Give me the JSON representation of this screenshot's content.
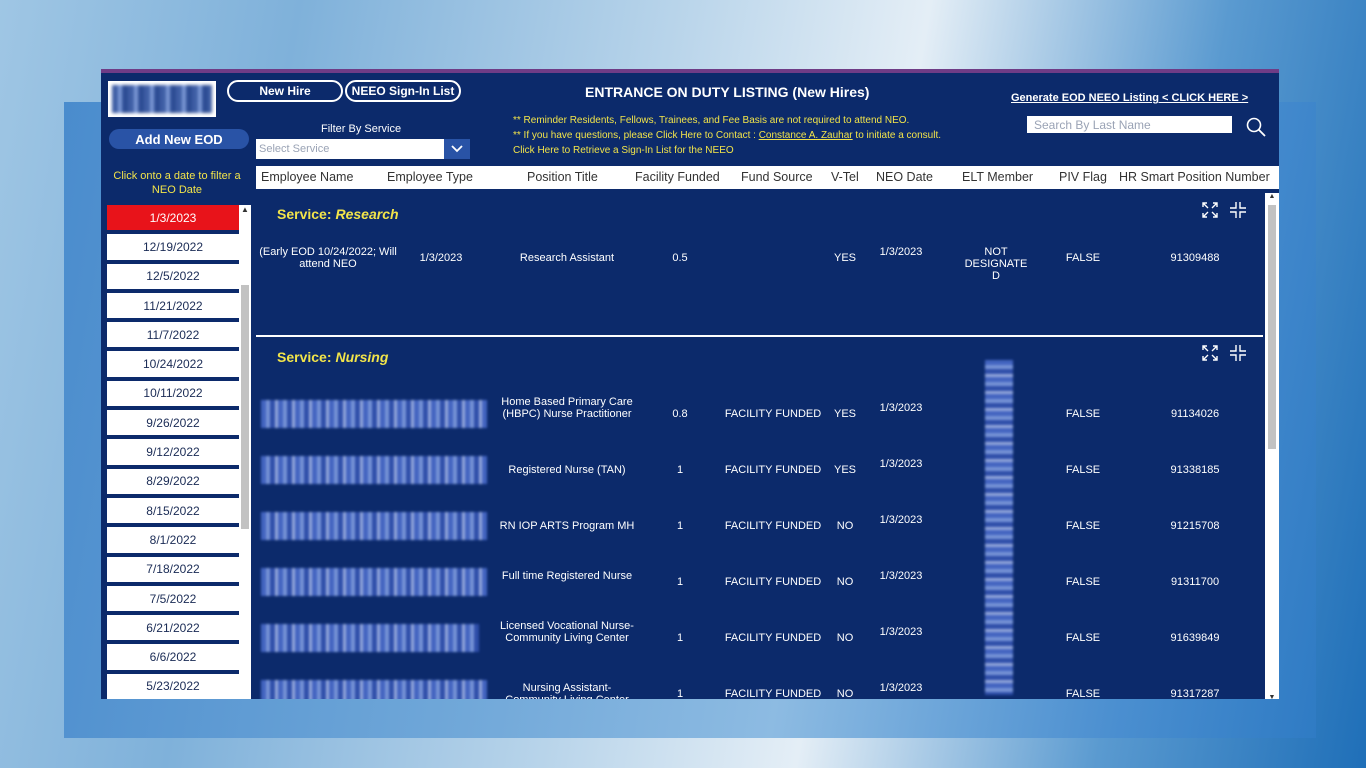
{
  "header": {
    "new_hire_label": "New Hire",
    "neeo_signin_label": "NEEO Sign-In List",
    "title": "ENTRANCE ON DUTY LISTING (New Hires)",
    "generate_link": "Generate EOD NEEO Listing < CLICK HERE >",
    "search_placeholder": "Search By Last Name"
  },
  "sidebar": {
    "add_button": "Add New EOD",
    "hint": "Click onto a date to filter a NEO Date",
    "dates": [
      "1/3/2023",
      "12/19/2022",
      "12/5/2022",
      "11/21/2022",
      "11/7/2022",
      "10/24/2022",
      "10/11/2022",
      "9/26/2022",
      "9/12/2022",
      "8/29/2022",
      "8/15/2022",
      "8/1/2022",
      "7/18/2022",
      "7/5/2022",
      "6/21/2022",
      "6/6/2022",
      "5/23/2022"
    ],
    "selected_index": 0
  },
  "filter": {
    "label": "Filter By Service",
    "placeholder": "Select Service"
  },
  "notes": {
    "line1": "** Reminder Residents, Fellows, Trainees, and Fee Basis are not required to attend NEO.",
    "line2_pre": "** If you have questions, please Click Here to Contact : ",
    "line2_link": "Constance A. Zauhar",
    "line2_post": " to initiate a consult.",
    "line3": "Click Here to Retrieve a Sign-In List for the NEEO"
  },
  "columns": [
    "Employee Name",
    "Employee Type",
    "Position Title",
    "Facility Funded",
    "Fund Source",
    "V-Tel",
    "NEO Date",
    "ELT Member",
    "PIV Flag",
    "HR Smart Position Number"
  ],
  "services": [
    {
      "prefix": "Service:",
      "name": "Research",
      "rows": [
        {
          "name": "(Early EOD 10/24/2022; Will attend NEO",
          "type": "1/3/2023",
          "title": "Research Assistant",
          "ff": "0.5",
          "source": "",
          "vtel": "YES",
          "neo": "1/3/2023",
          "elt": "NOT DESIGNATE D",
          "piv": "FALSE",
          "hr": "91309488"
        }
      ]
    },
    {
      "prefix": "Service:",
      "name": "Nursing",
      "rows": [
        {
          "name": "",
          "type": "",
          "title": "Home Based Primary Care (HBPC) Nurse Practitioner",
          "ff": "0.8",
          "source": "FACILITY FUNDED",
          "vtel": "YES",
          "neo": "1/3/2023",
          "elt": "",
          "piv": "FALSE",
          "hr": "91134026"
        },
        {
          "name": "",
          "type": "",
          "title": "Registered Nurse (TAN)",
          "ff": "1",
          "source": "FACILITY FUNDED",
          "vtel": "YES",
          "neo": "1/3/2023",
          "elt": "",
          "piv": "FALSE",
          "hr": "91338185"
        },
        {
          "name": "",
          "type": "",
          "title": "RN IOP ARTS Program MH",
          "ff": "1",
          "source": "FACILITY FUNDED",
          "vtel": "NO",
          "neo": "1/3/2023",
          "elt": "",
          "piv": "FALSE",
          "hr": "91215708"
        },
        {
          "name": "",
          "type": "",
          "title": "Full time Registered Nurse",
          "ff": "1",
          "source": "FACILITY FUNDED",
          "vtel": "NO",
          "neo": "1/3/2023",
          "elt": "",
          "piv": "FALSE",
          "hr": "91311700"
        },
        {
          "name": "",
          "type": "",
          "title": "Licensed Vocational Nurse-Community Living Center",
          "ff": "1",
          "source": "FACILITY FUNDED",
          "vtel": "NO",
          "neo": "1/3/2023",
          "elt": "",
          "piv": "FALSE",
          "hr": "91639849"
        },
        {
          "name": "",
          "type": "",
          "title": "Nursing Assistant-Community Living Center",
          "ff": "1",
          "source": "FACILITY FUNDED",
          "vtel": "NO",
          "neo": "1/3/2023",
          "elt": "",
          "piv": "FALSE",
          "hr": "91317287"
        }
      ]
    }
  ]
}
